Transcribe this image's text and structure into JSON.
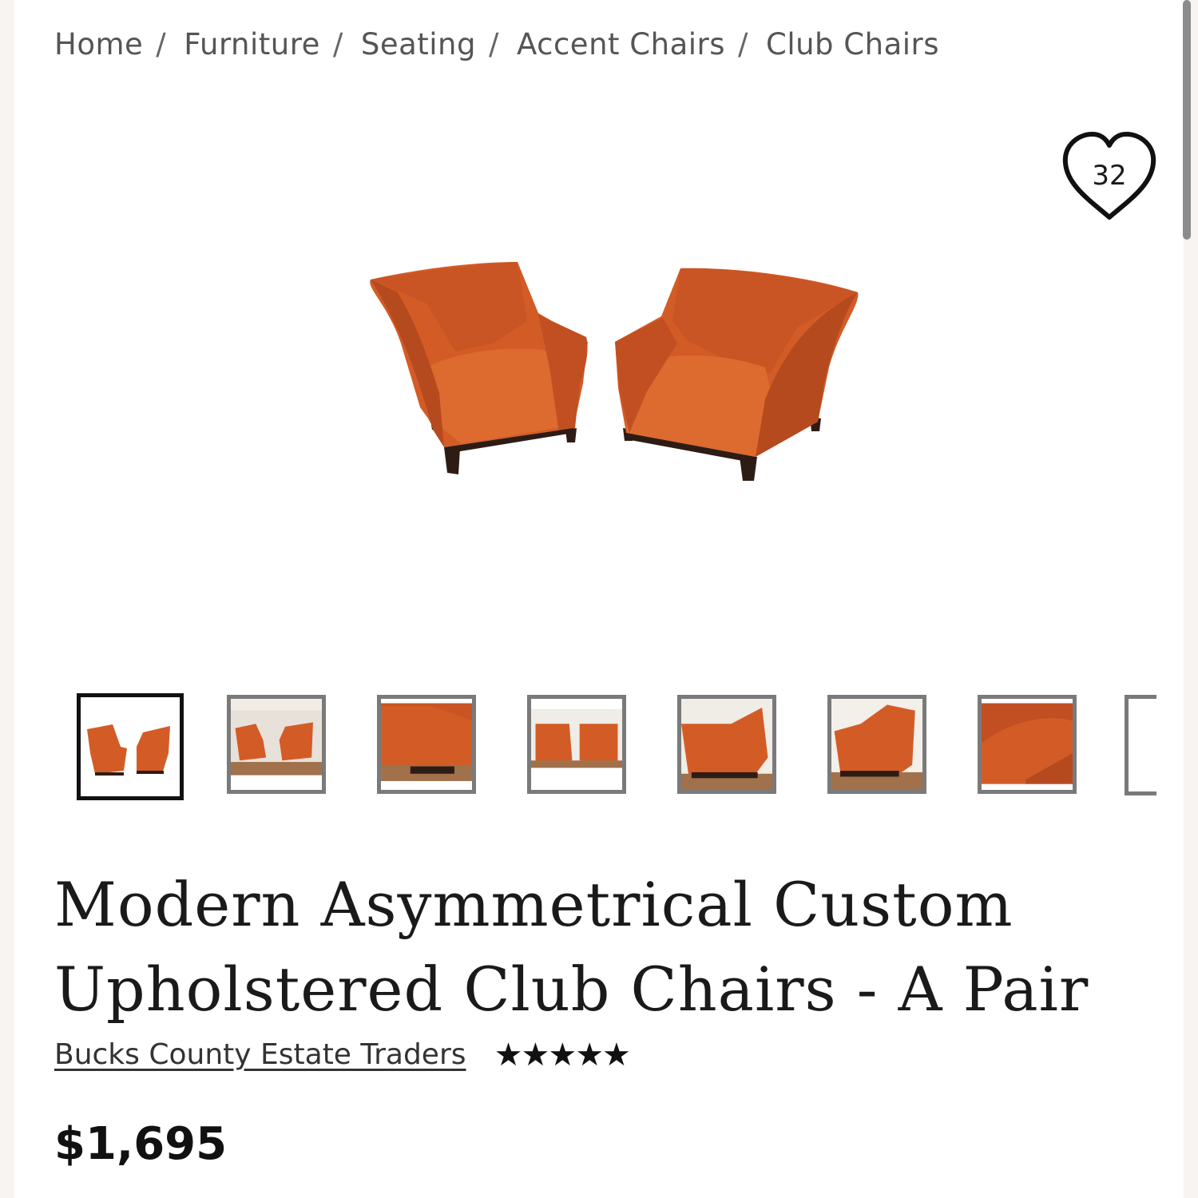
{
  "breadcrumb": {
    "items": [
      "Home",
      "Furniture",
      "Seating",
      "Accent Chairs",
      "Club Chairs"
    ],
    "separator": "/"
  },
  "favorite": {
    "count": "32",
    "icon": "heart-outline-icon"
  },
  "gallery": {
    "thumbnail_count_visible": 7,
    "active_index": 0
  },
  "product": {
    "title": "Modern Asymmetrical Custom Upholstered Club Chairs - A Pair",
    "seller": "Bucks County Estate Traders",
    "rating_stars": "★★★★★",
    "rating": 5,
    "price": "$1,695"
  },
  "colors": {
    "upholstery": "#d35c26",
    "wood": "#2e1c14"
  }
}
